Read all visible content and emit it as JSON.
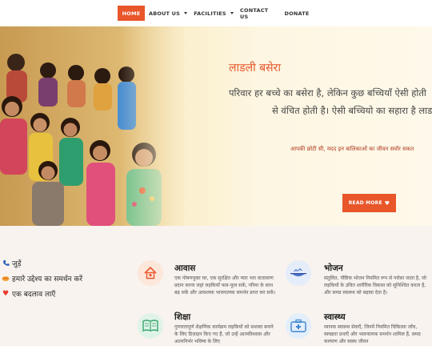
{
  "nav": {
    "items": [
      {
        "label": "HOME"
      },
      {
        "label": "ABOUT US"
      },
      {
        "label": "FACILITIES"
      },
      {
        "label": "CONTACT US"
      },
      {
        "label": "DONATE"
      }
    ]
  },
  "hero": {
    "title": "लाडली बसेरा",
    "line1": "परिवार हर बच्चे का बसेरा है, लेकिन कुछ बच्चियाँ ऐसी होती",
    "line2": "से वंचित होती है। ऐसी बच्चियो का सहारा है लाड",
    "tagline": "आपकी छोटी सी, मदद इन बालिकाओं का जीवन सवॉर सकत",
    "read_more": "READ MORE"
  },
  "side_links": [
    {
      "label": "जुड़ें",
      "icon": "phone-icon"
    },
    {
      "label": "हमारे उद्देश्य का समर्थन करें",
      "icon": "handshake-icon"
    },
    {
      "label": "एक बदलाव लाएँ",
      "icon": "heart-icon"
    }
  ],
  "features": [
    {
      "title": "आवास",
      "icon": "house-icon",
      "text": "एक पोषणयुक्त घर, एक सुरक्षित और प्यार भरा वातावरण प्रदान करना जहां लड़कियाँ फल-फूल सकें, गरिमा के साथ बढ़ सकें और आवश्यक भावनात्मक समर्थन प्राप्त कर सकें।"
    },
    {
      "title": "भोजन",
      "icon": "food-icon",
      "text": "संतुलित, पौष्टिक भोजन नियमित रूप से परोसा जाता है, जो लड़कियों के उचित शारीरिक विकास को सुनिश्चित करता है, और समग्र स्वास्थ्य को बढ़ावा देता है।"
    },
    {
      "title": "शिक्षा",
      "icon": "book-icon",
      "text": "गुणवत्तापूर्ण शैक्षणिक कार्यक्रम लड़कियों को सशक्त बनाने के लिए डिज़ाइन किए गए हैं, जो उन्हें आत्मविश्वास और आत्मनिर्भर भविष्य के लिए"
    },
    {
      "title": "स्वास्थ्य",
      "icon": "medical-kit-icon",
      "text": "व्यापक स्वास्थ्य सेवाएँ, जिनमें नियमित चिकित्सा जाँच, स्वच्छता प्रथाएँ और भावनात्मक समर्थन शामिल हैं, समग्र कल्याण और स्वस्थ जीवन"
    }
  ],
  "colors": {
    "accent": "#e8562a",
    "hero_bg": "#fbf0cf",
    "lower_bg": "#f8f3ef"
  }
}
